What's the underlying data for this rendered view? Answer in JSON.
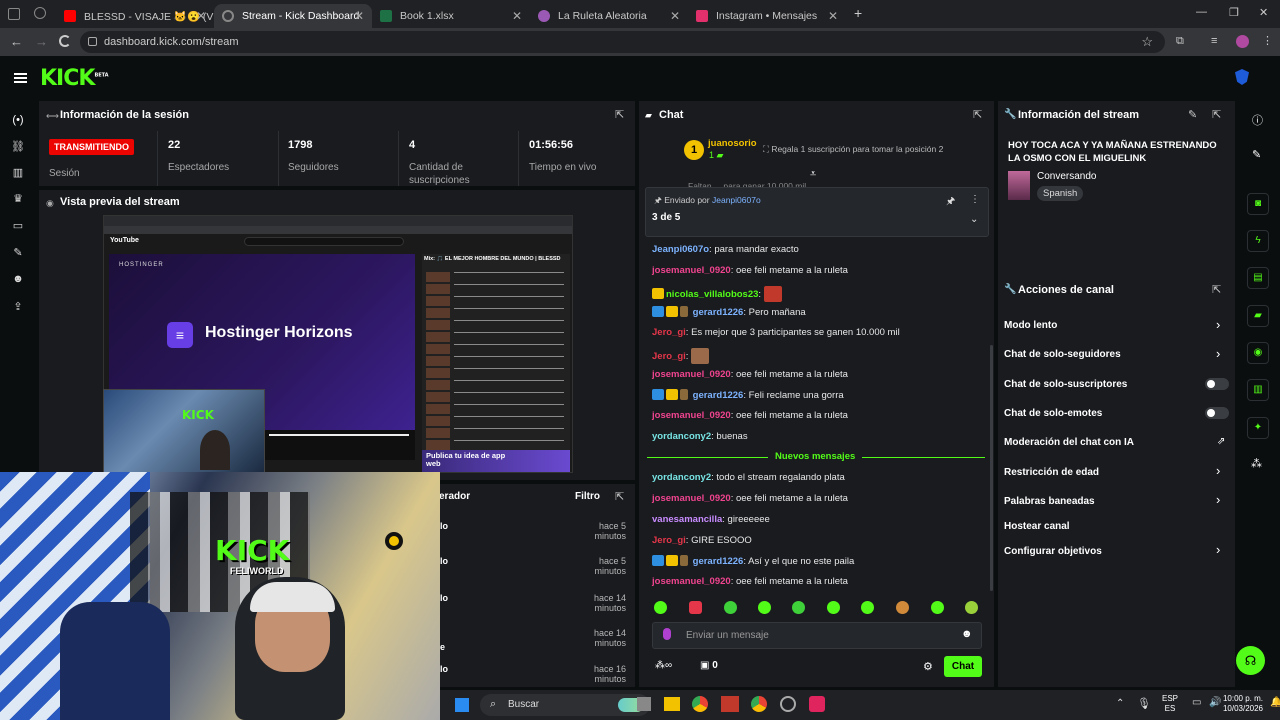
{
  "browser": {
    "tabs": [
      {
        "label": "BLESSD - VISAJE 🐱😮 (VI...",
        "color": "#ff0000"
      },
      {
        "label": "Stream - Kick Dashboard",
        "color": "#53fc18"
      },
      {
        "label": "Book 1.xlsx",
        "color": "#1e7145"
      },
      {
        "label": "La Ruleta Aleatoria",
        "color": "#9b59b6"
      },
      {
        "label": "Instagram • Mensajes",
        "color": "#e1306c"
      }
    ],
    "url": "dashboard.kick.com/stream"
  },
  "kick": {
    "logo": "KICK",
    "beta": "BETA"
  },
  "session": {
    "title": "Información de la sesión",
    "live": "TRANSMITIENDO",
    "session_label": "Sesión",
    "stats": [
      {
        "value": "22",
        "label": "Espectadores"
      },
      {
        "value": "1798",
        "label": "Seguidores"
      },
      {
        "value": "4",
        "label": "Cantidad de suscripciones"
      },
      {
        "value": "01:56:56",
        "label": "Tiempo en vivo"
      }
    ]
  },
  "preview": {
    "title": "Vista previa del stream",
    "ad_text": "Hostinger Horizons",
    "ad_brand": "HOSTINGER",
    "yt_logo": "YouTube",
    "now_playing": "Mix: 🎵 EL MEJOR HOMBRE DEL MUNDO | BLESSD",
    "publica": "Publica tu idea de app web",
    "overlay_brand": "KICK",
    "overlay_sub": "FELIWORLD"
  },
  "modlog": {
    "col_mod": "erador",
    "filter": "Filtro",
    "rows": [
      {
        "name": "lo",
        "time": "hace 5 minutos"
      },
      {
        "name": "lo",
        "time": "hace 5 minutos"
      },
      {
        "name": "lo",
        "time": "hace 14 minutos"
      },
      {
        "name": "e",
        "time": "hace 14 minutos"
      },
      {
        "name": "lo",
        "time": "hace 16 minutos"
      }
    ]
  },
  "chat": {
    "title": "Chat",
    "top_user": "juanosorio",
    "top_count": "1",
    "gift_text": "Regala 1 suscripción para tomar la posición 2",
    "truncated": "Faltan ... para ganar 10.000 mil",
    "pinned_by_label": "Enviado por",
    "pinned_by": "Jeanpi0607o",
    "pinned_count": "3 de 5",
    "new_messages": "Nuevos mensajes",
    "messages_before": [
      {
        "user": "Jeanpi0607o",
        "cls": "blue",
        "text": "para mandar exacto"
      },
      {
        "user": "josemanuel_0920",
        "cls": "pink",
        "text": "oee feli metame a la ruleta"
      },
      {
        "user": "nicolas_villalobos23",
        "cls": "green",
        "text": ""
      },
      {
        "user": "gerard1226",
        "cls": "blue",
        "text": "Pero mañana"
      },
      {
        "user": "Jero_gi",
        "cls": "red",
        "text": "Es mejor que 3 participantes se ganen 10.000 mil"
      },
      {
        "user": "Jero_gi",
        "cls": "red",
        "text": ""
      },
      {
        "user": "josemanuel_0920",
        "cls": "pink",
        "text": "oee feli metame a la ruleta"
      },
      {
        "user": "gerard1226",
        "cls": "blue",
        "text": "Feli reclame una gorra"
      },
      {
        "user": "josemanuel_0920",
        "cls": "pink",
        "text": "oee feli metame a la ruleta"
      },
      {
        "user": "yordancony2",
        "cls": "cyan",
        "text": "buenas"
      }
    ],
    "messages_after": [
      {
        "user": "yordancony2",
        "cls": "cyan",
        "text": "todo el stream regalando plata"
      },
      {
        "user": "josemanuel_0920",
        "cls": "pink",
        "text": "oee feli metame a la ruleta"
      },
      {
        "user": "vanesamancilla",
        "cls": "purple",
        "text": "gireeeeee"
      },
      {
        "user": "Jero_gi",
        "cls": "red",
        "text": "GIRE ESOOO"
      },
      {
        "user": "gerard1226",
        "cls": "blue",
        "text": "Así y el que no este paila"
      },
      {
        "user": "josemanuel_0920",
        "cls": "pink",
        "text": "oee feli metame a la ruleta"
      }
    ],
    "input_placeholder": "Enviar un mensaje",
    "points": "0",
    "send": "Chat"
  },
  "stream_info": {
    "title": "Información del stream",
    "stream_title": "HOY TOCA ACA Y YA MAÑANA ESTRENANDO LA OSMO CON EL MIGUELINK",
    "category": "Conversando",
    "language": "Spanish"
  },
  "actions": {
    "title": "Acciones de canal",
    "items": [
      "Modo lento",
      "Chat de solo-seguidores",
      "Chat de solo-suscriptores",
      "Chat de solo-emotes",
      "Moderación del chat con IA",
      "Restricción de edad",
      "Palabras baneadas",
      "Hostear canal",
      "Configurar objetivos"
    ]
  },
  "taskbar": {
    "search": "Buscar",
    "lang1": "ESP",
    "lang2": "ES",
    "time": "10:00 p. m.",
    "date": "10/03/2026"
  }
}
